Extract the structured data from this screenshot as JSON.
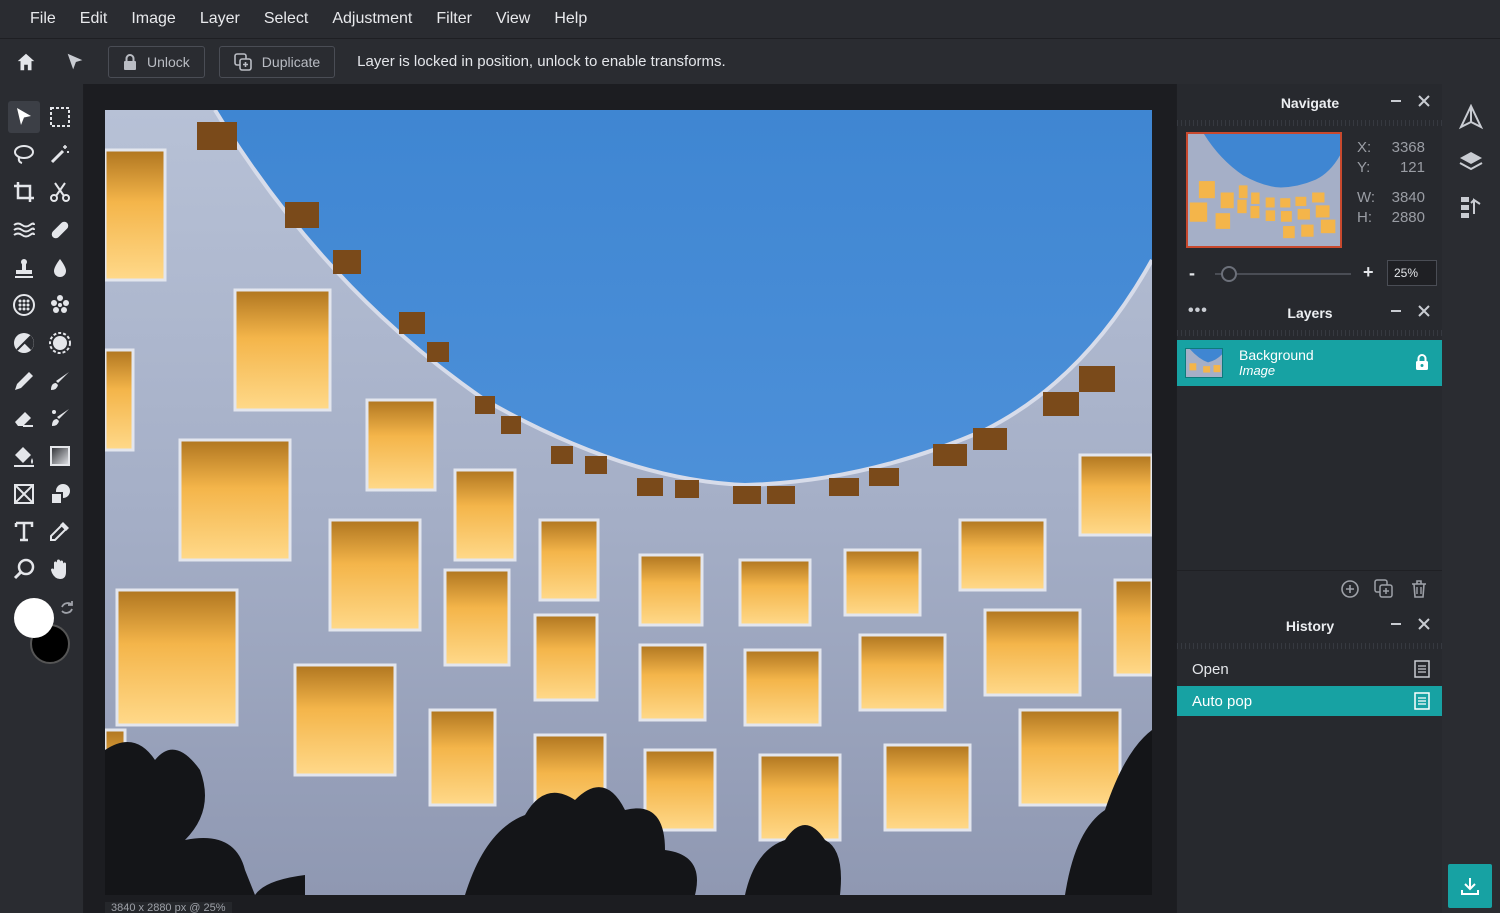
{
  "menu": [
    "File",
    "Edit",
    "Image",
    "Layer",
    "Select",
    "Adjustment",
    "Filter",
    "View",
    "Help"
  ],
  "options": {
    "unlock_label": "Unlock",
    "duplicate_label": "Duplicate",
    "message": "Layer is locked in position, unlock to enable transforms."
  },
  "canvas": {
    "status": "3840 x 2880 px @ 25%"
  },
  "navigate": {
    "title": "Navigate",
    "x_label": "X:",
    "x_value": "3368",
    "y_label": "Y:",
    "y_value": "121",
    "w_label": "W:",
    "w_value": "3840",
    "h_label": "H:",
    "h_value": "2880",
    "zoom_minus": "-",
    "zoom_plus": "+",
    "zoom_value": "25%",
    "zoom_level": 0.25
  },
  "layers": {
    "title": "Layers",
    "items": [
      {
        "name": "Background",
        "type": "Image",
        "locked": true
      }
    ]
  },
  "history": {
    "title": "History",
    "items": [
      {
        "label": "Open",
        "active": false
      },
      {
        "label": "Auto pop",
        "active": true
      }
    ]
  },
  "colors": {
    "accent": "#17a2a3",
    "foreground": "#ffffff",
    "background": "#000000"
  },
  "icons": {
    "toolbar": [
      "move-icon",
      "marquee-icon",
      "lasso-icon",
      "magic-wand-icon",
      "crop-icon",
      "cut-icon",
      "liquify-icon",
      "heal-icon",
      "stamp-icon",
      "blur-icon",
      "sponge-icon",
      "pattern-icon",
      "dodge-icon",
      "sharpen-icon",
      "pencil-icon",
      "brush-icon",
      "eraser-icon",
      "color-replace-icon",
      "fill-icon",
      "gradient-icon",
      "frame-icon",
      "shape-icon",
      "text-icon",
      "eyedropper-icon",
      "zoom-icon",
      "hand-icon"
    ]
  }
}
